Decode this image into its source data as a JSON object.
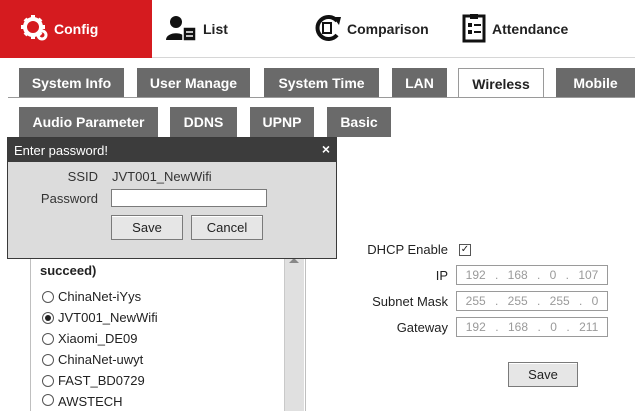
{
  "nav": {
    "config": "Config",
    "list": "List",
    "comparison": "Comparison",
    "attendance": "Attendance"
  },
  "tabs_row1": [
    "System Info",
    "User Manage",
    "System Time",
    "LAN",
    "Wireless",
    "Mobile"
  ],
  "tabs_row2": [
    "Audio Parameter",
    "DDNS",
    "UPNP",
    "Basic"
  ],
  "modal": {
    "title": "Enter password!",
    "close": "×",
    "ssid_label": "SSID",
    "ssid_value": "JVT001_NewWifi",
    "password_label": "Password",
    "password_value": "",
    "save": "Save",
    "cancel": "Cancel"
  },
  "wifi": {
    "status_text": "succeed)",
    "items": [
      {
        "name": "ChinaNet-iYys",
        "selected": false
      },
      {
        "name": "JVT001_NewWifi",
        "selected": true
      },
      {
        "name": "Xiaomi_DE09",
        "selected": false
      },
      {
        "name": "ChinaNet-uwyt",
        "selected": false
      },
      {
        "name": "FAST_BD0729",
        "selected": false
      },
      {
        "name": "AWSTECH",
        "selected": false
      }
    ]
  },
  "network": {
    "dhcp_label": "DHCP Enable",
    "dhcp_checked": true,
    "ip_label": "IP",
    "ip": [
      "192",
      "168",
      "0",
      "107"
    ],
    "mask_label": "Subnet Mask",
    "mask": [
      "255",
      "255",
      "255",
      "0"
    ],
    "gateway_label": "Gateway",
    "gateway": [
      "192",
      "168",
      "0",
      "211"
    ],
    "save": "Save"
  },
  "colors": {
    "accent_red": "#d51b1f",
    "tab_gray": "#6a6a6a",
    "modal_title": "#3c3c3c"
  }
}
